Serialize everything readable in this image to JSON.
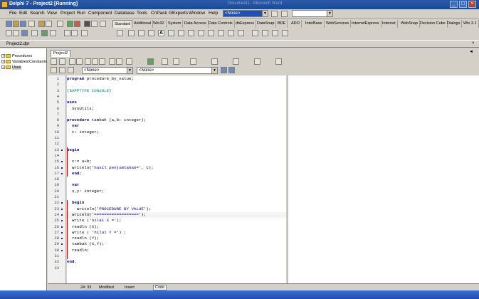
{
  "window": {
    "title": "Delphi 7 - Project2 [Running]",
    "ghost_title": "Document1 - Microsoft Word"
  },
  "menu": [
    "File",
    "Edit",
    "Search",
    "View",
    "Project",
    "Run",
    "Component",
    "Database",
    "Tools",
    "CnPack",
    "GExperts",
    "Window",
    "Help"
  ],
  "combos": {
    "desktop": "<None>",
    "second": ""
  },
  "palette_tabs": [
    "Standard",
    "Additional",
    "Win32",
    "System",
    "Data Access",
    "Data Controls",
    "dbExpress",
    "DataSnap",
    "BDE",
    "ADO",
    "InterBase",
    "WebServices",
    "InternetExpress",
    "Internet",
    "WebSnap",
    "Decision Cube",
    "Dialogs",
    "Win 3.1"
  ],
  "project_file": "Project2.dpr",
  "tree": [
    {
      "label": "Procedures"
    },
    {
      "label": "Variables/Constants"
    },
    {
      "label": "Uses"
    }
  ],
  "editor": {
    "tab": "Project2",
    "combo1": "<None>",
    "combo2": "<None>"
  },
  "code_lines": [
    {
      "n": "1",
      "parts": [
        {
          "t": "program",
          "c": "kw"
        },
        {
          "t": " procedure_by_value;"
        }
      ]
    },
    {
      "n": "2",
      "parts": []
    },
    {
      "n": "3",
      "parts": [
        {
          "t": "{$APPTYPE CONSOLE}",
          "c": "dir"
        }
      ]
    },
    {
      "n": "4",
      "parts": []
    },
    {
      "n": "5",
      "parts": [
        {
          "t": "uses",
          "c": "kw"
        }
      ]
    },
    {
      "n": "6",
      "parts": [
        {
          "t": "  SysUtils;"
        }
      ]
    },
    {
      "n": "7",
      "parts": []
    },
    {
      "n": "8",
      "parts": [
        {
          "t": "procedure",
          "c": "kw"
        },
        {
          "t": " tambah (a,b: integer);"
        }
      ]
    },
    {
      "n": "9",
      "parts": [
        {
          "t": "  "
        },
        {
          "t": "var",
          "c": "kw"
        }
      ]
    },
    {
      "n": "10",
      "parts": [
        {
          "t": "  c: integer;"
        }
      ]
    },
    {
      "n": "11",
      "parts": []
    },
    {
      "n": "12",
      "parts": []
    },
    {
      "n": "13",
      "parts": [
        {
          "t": "begin",
          "c": "kw"
        }
      ]
    },
    {
      "n": "14",
      "parts": []
    },
    {
      "n": "15",
      "parts": [
        {
          "t": "  c:= a+b;"
        }
      ]
    },
    {
      "n": "16",
      "parts": [
        {
          "t": "  writeln("
        },
        {
          "t": "'hasil penjumlahan='",
          "c": "str"
        },
        {
          "t": ", c);"
        }
      ]
    },
    {
      "n": "17",
      "parts": [
        {
          "t": "  "
        },
        {
          "t": "end",
          "c": "kw"
        },
        {
          "t": ";"
        }
      ]
    },
    {
      "n": "18",
      "parts": []
    },
    {
      "n": "19",
      "parts": [
        {
          "t": "  "
        },
        {
          "t": "var",
          "c": "kw"
        }
      ]
    },
    {
      "n": "20",
      "parts": [
        {
          "t": "  x,y: integer;"
        }
      ]
    },
    {
      "n": "21",
      "parts": []
    },
    {
      "n": "22",
      "parts": [
        {
          "t": "  "
        },
        {
          "t": "begin",
          "c": "kw"
        }
      ]
    },
    {
      "n": "23",
      "parts": [
        {
          "t": "    writeln("
        },
        {
          "t": "'PROCEDURE BY VALUE'",
          "c": "str"
        },
        {
          "t": ");"
        }
      ]
    },
    {
      "n": "24",
      "parts": [
        {
          "t": "  writeln("
        },
        {
          "t": "'=================='",
          "c": "str"
        },
        {
          "t": ");"
        }
      ]
    },
    {
      "n": "25",
      "parts": [
        {
          "t": "  write ("
        },
        {
          "t": "'nilai X ='",
          "c": "str"
        },
        {
          "t": ");"
        }
      ]
    },
    {
      "n": "26",
      "parts": [
        {
          "t": "  readln (X);"
        }
      ]
    },
    {
      "n": "27",
      "parts": [
        {
          "t": "  write ( "
        },
        {
          "t": "'nilai Y ='",
          "c": "str"
        },
        {
          "t": ") ;"
        }
      ]
    },
    {
      "n": "28",
      "parts": [
        {
          "t": "  readln (Y);"
        }
      ]
    },
    {
      "n": "29",
      "parts": [
        {
          "t": "  tambah (X,Y);"
        }
      ]
    },
    {
      "n": "30",
      "parts": [
        {
          "t": "  readln;"
        }
      ]
    },
    {
      "n": "31",
      "parts": []
    },
    {
      "n": "32",
      "parts": [
        {
          "t": "end",
          "c": "kw"
        },
        {
          "t": "."
        }
      ]
    },
    {
      "n": "33",
      "parts": []
    }
  ],
  "status": {
    "position": "24: 33",
    "modified": "Modified",
    "mode": "Insert",
    "tab": "Code"
  },
  "icons": [
    "app-icon",
    "new-icon",
    "open-icon",
    "save-icon",
    "run-icon",
    "pause-icon",
    "folder-icon",
    "close-icon",
    "minimize-icon",
    "maximize-icon"
  ]
}
